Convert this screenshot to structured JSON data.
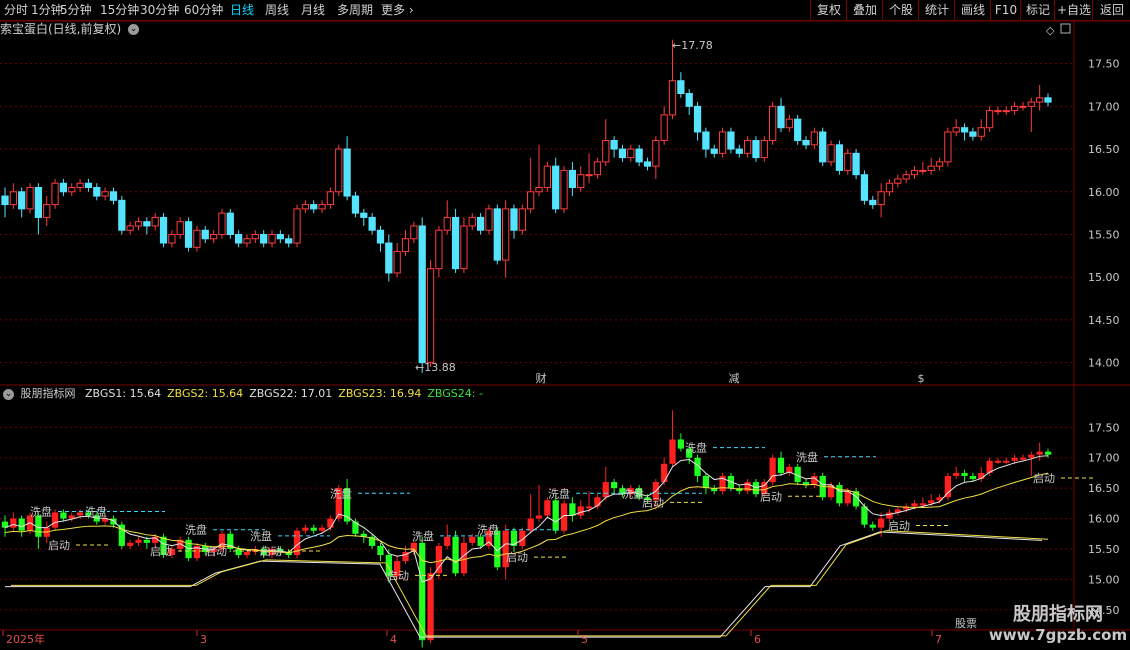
{
  "toolbar": {
    "periods": [
      {
        "label": "分时",
        "active": false
      },
      {
        "label": "1分钟",
        "active": false
      },
      {
        "label": "5分钟",
        "active": false
      },
      {
        "label": "15分钟",
        "active": false
      },
      {
        "label": "30分钟",
        "active": false
      },
      {
        "label": "60分钟",
        "active": false
      },
      {
        "label": "日线",
        "active": true
      },
      {
        "label": "周线",
        "active": false
      },
      {
        "label": "月线",
        "active": false
      },
      {
        "label": "多周期",
        "active": false
      },
      {
        "label": "更多",
        "active": false
      }
    ],
    "right_buttons": [
      "复权",
      "叠加",
      "个股",
      "统计",
      "画线",
      "F10",
      "标记",
      "+自选",
      "返回"
    ]
  },
  "main_chart": {
    "title": "索宝蛋白(日线,前复权)",
    "y_ticks": [
      "17.50",
      "17.00",
      "16.50",
      "16.00",
      "15.50",
      "15.00",
      "14.50",
      "14.00"
    ],
    "high_marker": "17.78",
    "low_marker": "13.88",
    "event_markers": [
      {
        "label": "财",
        "color": "#4aa0ff"
      },
      {
        "label": "减",
        "color": "#40e040"
      },
      {
        "label": "$",
        "color": "#ff4040"
      }
    ]
  },
  "indicator": {
    "name": "股朋指标网",
    "fields": [
      {
        "label": "ZBGS1:",
        "value": "15.64",
        "color": "#e0e0e0"
      },
      {
        "label": "ZBGS2:",
        "value": "15.64",
        "color": "#f0e040"
      },
      {
        "label": "ZBGS22:",
        "value": "17.01",
        "color": "#e0e0e0"
      },
      {
        "label": "ZBGS23:",
        "value": "16.94",
        "color": "#f0e040"
      },
      {
        "label": "ZBGS24:",
        "value": "-",
        "color": "#40e040"
      }
    ],
    "y_ticks": [
      "17.50",
      "17.00",
      "16.50",
      "16.00",
      "15.50",
      "15.00",
      "14.50"
    ],
    "signal_labels": {
      "wash": "洗盘",
      "start": "启动"
    }
  },
  "date_axis": {
    "labels": [
      "2025年",
      "3",
      "4",
      "5",
      "6",
      "7"
    ]
  },
  "watermark": {
    "name": "股朋指标网",
    "url": "www.7gpzb.com",
    "faint": "股票"
  },
  "chart_data": {
    "type": "candlestick",
    "ylim": [
      13.75,
      17.8
    ],
    "candles": [
      [
        15.95,
        15.85,
        16.05,
        15.7
      ],
      [
        15.85,
        16.0,
        16.1,
        15.8
      ],
      [
        16.0,
        15.8,
        16.05,
        15.7
      ],
      [
        15.8,
        16.05,
        16.1,
        15.75
      ],
      [
        16.05,
        15.7,
        16.1,
        15.5
      ],
      [
        15.7,
        15.85,
        15.95,
        15.6
      ],
      [
        15.85,
        16.1,
        16.15,
        15.8
      ],
      [
        16.1,
        16.0,
        16.15,
        15.95
      ],
      [
        16.0,
        16.05,
        16.1,
        15.95
      ],
      [
        16.05,
        16.1,
        16.15,
        16.0
      ],
      [
        16.1,
        16.05,
        16.15,
        16.0
      ],
      [
        16.05,
        15.95,
        16.1,
        15.9
      ],
      [
        15.95,
        16.0,
        16.05,
        15.9
      ],
      [
        16.0,
        15.9,
        16.05,
        15.85
      ],
      [
        15.9,
        15.55,
        15.95,
        15.5
      ],
      [
        15.55,
        15.6,
        15.65,
        15.5
      ],
      [
        15.6,
        15.65,
        15.7,
        15.55
      ],
      [
        15.65,
        15.6,
        15.7,
        15.5
      ],
      [
        15.6,
        15.7,
        15.75,
        15.55
      ],
      [
        15.7,
        15.4,
        15.75,
        15.35
      ],
      [
        15.4,
        15.5,
        15.55,
        15.35
      ],
      [
        15.5,
        15.65,
        15.7,
        15.45
      ],
      [
        15.65,
        15.35,
        15.7,
        15.3
      ],
      [
        15.35,
        15.55,
        15.6,
        15.3
      ],
      [
        15.55,
        15.45,
        15.6,
        15.4
      ],
      [
        15.45,
        15.5,
        15.55,
        15.4
      ],
      [
        15.5,
        15.75,
        15.8,
        15.45
      ],
      [
        15.75,
        15.5,
        15.8,
        15.45
      ],
      [
        15.5,
        15.4,
        15.55,
        15.35
      ],
      [
        15.4,
        15.45,
        15.5,
        15.35
      ],
      [
        15.45,
        15.5,
        15.55,
        15.4
      ],
      [
        15.5,
        15.4,
        15.55,
        15.35
      ],
      [
        15.4,
        15.5,
        15.55,
        15.35
      ],
      [
        15.5,
        15.45,
        15.55,
        15.4
      ],
      [
        15.45,
        15.4,
        15.5,
        15.35
      ],
      [
        15.4,
        15.8,
        15.85,
        15.35
      ],
      [
        15.8,
        15.85,
        15.9,
        15.75
      ],
      [
        15.85,
        15.8,
        15.9,
        15.75
      ],
      [
        15.8,
        15.85,
        15.9,
        15.75
      ],
      [
        15.85,
        16.0,
        16.05,
        15.8
      ],
      [
        16.0,
        16.5,
        16.55,
        15.95
      ],
      [
        16.5,
        15.95,
        16.65,
        15.9
      ],
      [
        15.95,
        15.75,
        16.0,
        15.7
      ],
      [
        15.75,
        15.7,
        15.8,
        15.6
      ],
      [
        15.7,
        15.55,
        15.75,
        15.5
      ],
      [
        15.55,
        15.4,
        15.6,
        15.3
      ],
      [
        15.4,
        15.05,
        15.5,
        14.95
      ],
      [
        15.05,
        15.3,
        15.4,
        15.0
      ],
      [
        15.3,
        15.45,
        15.55,
        15.25
      ],
      [
        15.45,
        15.6,
        15.65,
        15.4
      ],
      [
        15.6,
        14.0,
        15.7,
        13.88
      ],
      [
        14.0,
        15.1,
        15.2,
        13.95
      ],
      [
        15.1,
        15.55,
        15.6,
        15.0
      ],
      [
        15.55,
        15.7,
        15.9,
        15.5
      ],
      [
        15.7,
        15.1,
        15.8,
        15.05
      ],
      [
        15.1,
        15.6,
        15.7,
        15.05
      ],
      [
        15.6,
        15.7,
        15.75,
        15.55
      ],
      [
        15.7,
        15.55,
        15.75,
        15.5
      ],
      [
        15.55,
        15.8,
        15.85,
        15.5
      ],
      [
        15.8,
        15.2,
        15.85,
        15.15
      ],
      [
        15.2,
        15.8,
        15.9,
        15.0
      ],
      [
        15.8,
        15.55,
        15.85,
        15.45
      ],
      [
        15.55,
        15.8,
        15.85,
        15.5
      ],
      [
        15.8,
        16.0,
        16.4,
        15.75
      ],
      [
        16.0,
        16.05,
        16.55,
        15.95
      ],
      [
        16.05,
        16.3,
        16.35,
        16.0
      ],
      [
        16.3,
        15.8,
        16.4,
        15.75
      ],
      [
        15.8,
        16.25,
        16.3,
        15.75
      ],
      [
        16.25,
        16.05,
        16.35,
        15.95
      ],
      [
        16.05,
        16.2,
        16.3,
        16.0
      ],
      [
        16.2,
        16.2,
        16.45,
        16.1
      ],
      [
        16.2,
        16.35,
        16.4,
        16.15
      ],
      [
        16.35,
        16.6,
        16.85,
        16.3
      ],
      [
        16.6,
        16.5,
        16.65,
        16.4
      ],
      [
        16.5,
        16.4,
        16.55,
        16.35
      ],
      [
        16.4,
        16.5,
        16.55,
        16.35
      ],
      [
        16.5,
        16.35,
        16.55,
        16.3
      ],
      [
        16.35,
        16.3,
        16.4,
        16.25
      ],
      [
        16.3,
        16.6,
        16.65,
        16.15
      ],
      [
        16.6,
        16.9,
        17.0,
        16.55
      ],
      [
        16.9,
        17.3,
        17.78,
        16.85
      ],
      [
        17.3,
        17.15,
        17.4,
        17.1
      ],
      [
        17.15,
        17.0,
        17.2,
        16.9
      ],
      [
        17.0,
        16.7,
        17.05,
        16.6
      ],
      [
        16.7,
        16.5,
        16.75,
        16.4
      ],
      [
        16.5,
        16.45,
        16.55,
        16.4
      ],
      [
        16.45,
        16.7,
        16.75,
        16.4
      ],
      [
        16.7,
        16.5,
        16.75,
        16.45
      ],
      [
        16.5,
        16.45,
        16.55,
        16.4
      ],
      [
        16.45,
        16.6,
        16.65,
        16.4
      ],
      [
        16.6,
        16.4,
        16.65,
        16.35
      ],
      [
        16.4,
        16.6,
        16.65,
        16.35
      ],
      [
        16.6,
        17.0,
        17.05,
        16.55
      ],
      [
        17.0,
        16.75,
        17.1,
        16.7
      ],
      [
        16.75,
        16.85,
        16.9,
        16.7
      ],
      [
        16.85,
        16.6,
        16.9,
        16.55
      ],
      [
        16.6,
        16.55,
        16.65,
        16.5
      ],
      [
        16.55,
        16.7,
        16.75,
        16.5
      ],
      [
        16.7,
        16.35,
        16.75,
        16.3
      ],
      [
        16.35,
        16.55,
        16.6,
        16.3
      ],
      [
        16.55,
        16.25,
        16.6,
        16.2
      ],
      [
        16.25,
        16.45,
        16.5,
        16.2
      ],
      [
        16.45,
        16.2,
        16.5,
        16.15
      ],
      [
        16.2,
        15.9,
        16.25,
        15.85
      ],
      [
        15.9,
        15.85,
        15.95,
        15.8
      ],
      [
        15.85,
        16.0,
        16.1,
        15.7
      ],
      [
        16.0,
        16.1,
        16.15,
        15.95
      ],
      [
        16.1,
        16.15,
        16.2,
        16.05
      ],
      [
        16.15,
        16.2,
        16.25,
        16.1
      ],
      [
        16.2,
        16.25,
        16.3,
        16.15
      ],
      [
        16.25,
        16.25,
        16.35,
        16.2
      ],
      [
        16.25,
        16.3,
        16.4,
        16.2
      ],
      [
        16.3,
        16.35,
        16.4,
        16.25
      ],
      [
        16.35,
        16.7,
        16.75,
        16.3
      ],
      [
        16.7,
        16.75,
        16.85,
        16.65
      ],
      [
        16.75,
        16.7,
        16.8,
        16.6
      ],
      [
        16.7,
        16.65,
        16.75,
        16.6
      ],
      [
        16.65,
        16.75,
        16.85,
        16.6
      ],
      [
        16.75,
        16.95,
        17.0,
        16.7
      ],
      [
        16.95,
        16.95,
        17.0,
        16.9
      ],
      [
        16.95,
        16.95,
        17.0,
        16.9
      ],
      [
        16.95,
        17.0,
        17.05,
        16.9
      ],
      [
        17.0,
        17.0,
        17.05,
        16.95
      ],
      [
        17.0,
        17.05,
        17.1,
        16.7
      ],
      [
        17.05,
        17.1,
        17.25,
        16.95
      ],
      [
        17.1,
        17.05,
        17.15,
        17.0
      ]
    ]
  }
}
